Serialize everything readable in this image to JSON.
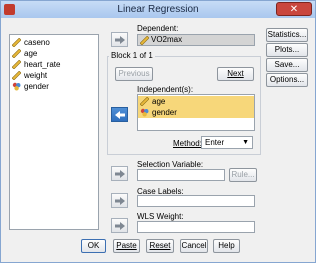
{
  "window": {
    "title": "Linear Regression",
    "close_glyph": "✕"
  },
  "variables_list": {
    "items": [
      {
        "label": "caseno",
        "icon": "scale-ruler-icon"
      },
      {
        "label": "age",
        "icon": "scale-ruler-icon"
      },
      {
        "label": "heart_rate",
        "icon": "scale-ruler-icon"
      },
      {
        "label": "weight",
        "icon": "scale-ruler-icon"
      },
      {
        "label": "gender",
        "icon": "nominal-circles-icon"
      }
    ]
  },
  "dependent": {
    "label": "Dependent:",
    "value": "VO2max",
    "icon": "scale-ruler-icon"
  },
  "block": {
    "label": "Block 1 of 1",
    "previous_label": "Previous",
    "next_label": "Next",
    "independents_label": "Independent(s):",
    "independents": [
      {
        "label": "age",
        "icon": "scale-ruler-icon"
      },
      {
        "label": "gender",
        "icon": "nominal-circles-icon"
      }
    ],
    "method_label": "Method:",
    "method_value": "Enter"
  },
  "selection_variable": {
    "label": "Selection Variable:",
    "rule_label": "Rule..."
  },
  "case_labels": {
    "label": "Case Labels:"
  },
  "wls_weight": {
    "label": "WLS Weight:"
  },
  "side_buttons": {
    "statistics": "Statistics...",
    "plots": "Plots...",
    "save": "Save...",
    "options": "Options..."
  },
  "bottom_buttons": {
    "ok": "OK",
    "paste": "Paste",
    "reset": "Reset",
    "cancel": "Cancel",
    "help": "Help"
  },
  "colors": {
    "selection": "#f7d77a",
    "active_arrow": "#2f6fbe",
    "title_bar": "#b9d2f3",
    "close": "#c9463d"
  }
}
